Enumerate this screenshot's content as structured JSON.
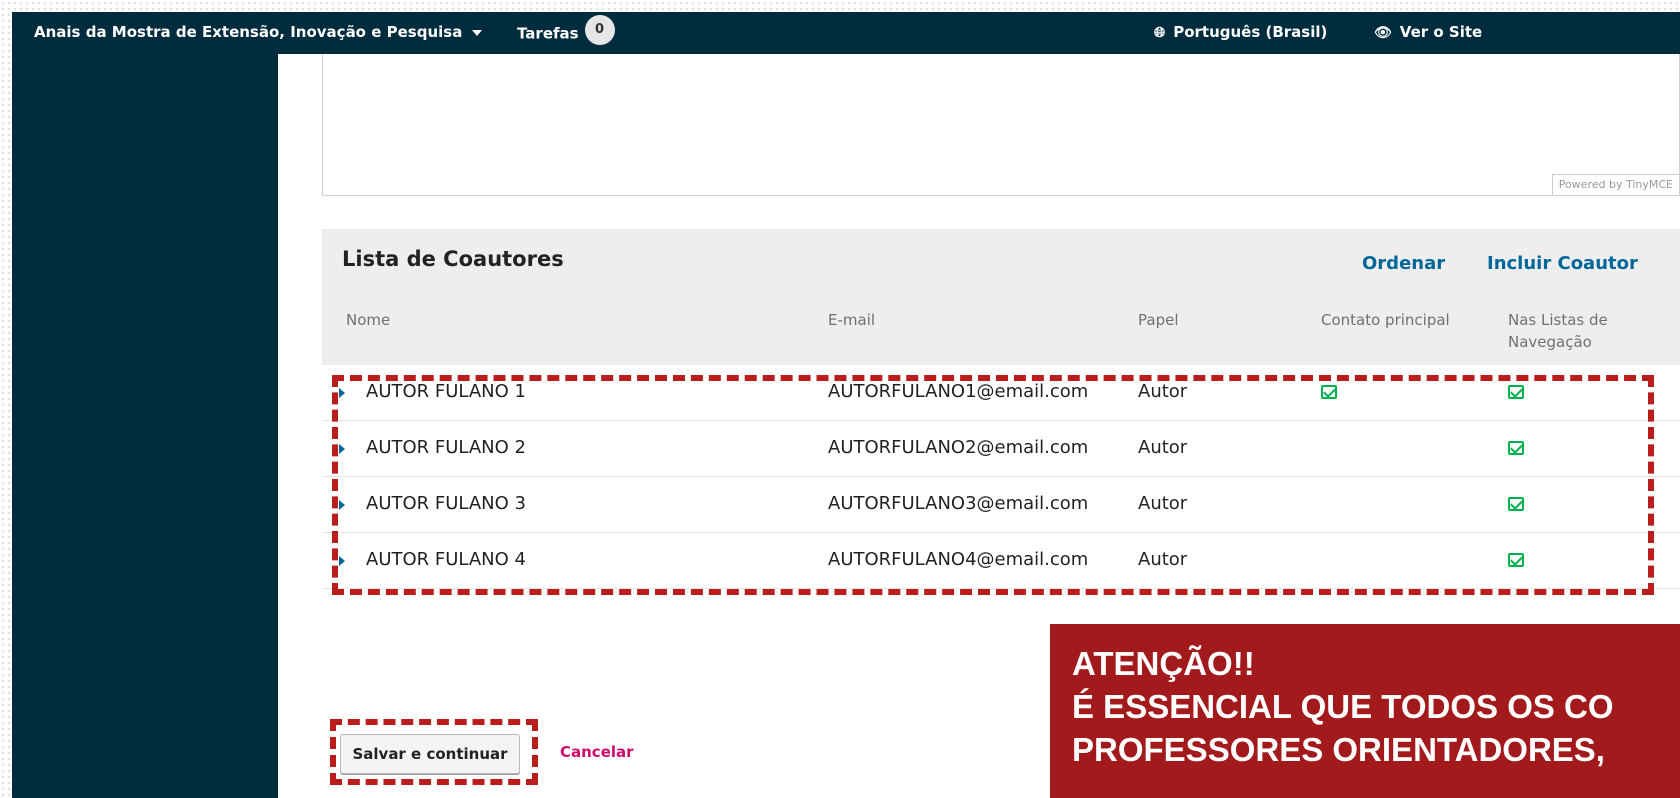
{
  "topbar": {
    "site_title": "Anais da Mostra de Extensão, Inovação e Pesquisa",
    "tasks_label": "Tarefas",
    "tasks_count": "0",
    "language": "Português (Brasil)",
    "view_site": "Ver o Site"
  },
  "editor": {
    "powered_by": "Powered by TinyMCE"
  },
  "coauthors": {
    "title": "Lista de Coautores",
    "order_link": "Ordenar",
    "add_link": "Incluir Coautor",
    "columns": {
      "name": "Nome",
      "email": "E-mail",
      "role": "Papel",
      "primary_contact": "Contato principal",
      "browse_lists_1": "Nas Listas de",
      "browse_lists_2": "Navegação"
    },
    "rows": [
      {
        "name": "AUTOR FULANO 1",
        "email": "AUTORFULANO1@email.com",
        "role": "Autor",
        "primary_contact": true,
        "in_browse_lists": true
      },
      {
        "name": "AUTOR FULANO 2",
        "email": "AUTORFULANO2@email.com",
        "role": "Autor",
        "primary_contact": false,
        "in_browse_lists": true
      },
      {
        "name": "AUTOR FULANO 3",
        "email": "AUTORFULANO3@email.com",
        "role": "Autor",
        "primary_contact": false,
        "in_browse_lists": true
      },
      {
        "name": "AUTOR FULANO 4",
        "email": "AUTORFULANO4@email.com",
        "role": "Autor",
        "primary_contact": false,
        "in_browse_lists": true
      }
    ]
  },
  "actions": {
    "save_label": "Salvar e continuar",
    "cancel_label": "Cancelar"
  },
  "warning": {
    "line1": "ATENÇÃO!!",
    "line2": "É ESSENCIAL QUE TODOS OS CO",
    "line3": "PROFESSORES ORIENTADORES,"
  },
  "colors": {
    "topbar": "#002c3e",
    "link": "#006798",
    "cancel": "#d00a6c",
    "check": "#00b24e",
    "annotation_red": "#bb1d1d",
    "warning_bg": "#a31a1d"
  }
}
